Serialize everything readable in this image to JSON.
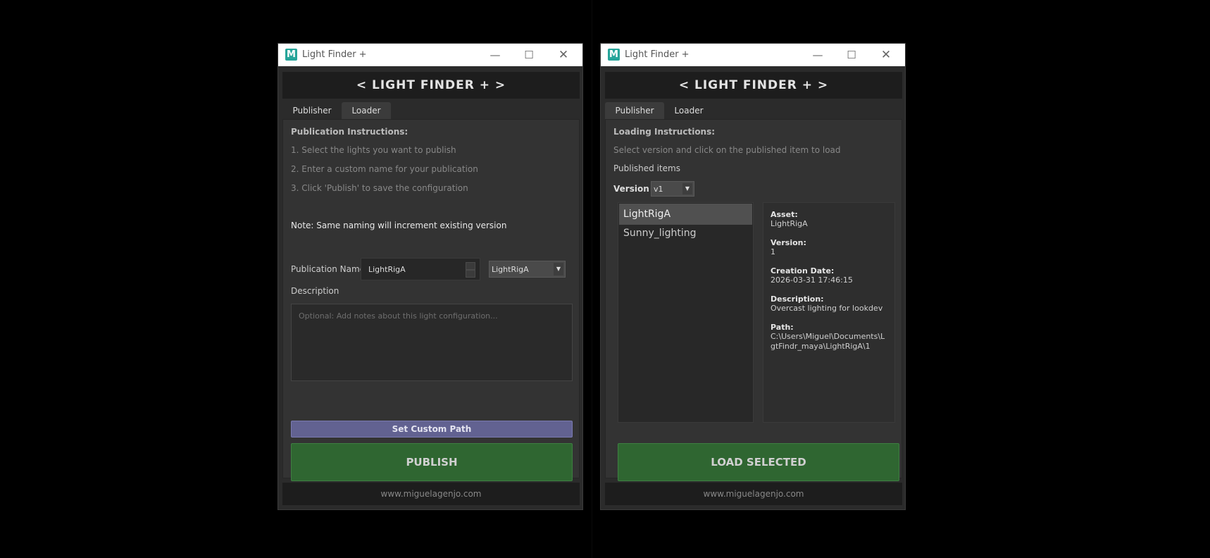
{
  "window_title": "Light Finder +",
  "header_title": "< LIGHT FINDER + >",
  "tabs": {
    "publisher": "Publisher",
    "loader": "Loader"
  },
  "publisher": {
    "instructions_heading": "Publication Instructions:",
    "steps": [
      "1. Select the lights you want to publish",
      "2. Enter a custom name for your publication",
      "3. Click 'Publish' to save the configuration"
    ],
    "note": "Note: Same naming will increment existing version",
    "publication_name_label": "Publication Name",
    "publication_name_value": "LightRigA",
    "publication_dropdown_value": "LightRigA",
    "description_label": "Description",
    "description_placeholder": "Optional: Add notes about this light configuration...",
    "set_custom_path_label": "Set Custom Path",
    "publish_label": "PUBLISH"
  },
  "loader": {
    "instructions_heading": "Loading Instructions:",
    "instructions_text": "Select version and click on the published item to load",
    "published_items_label": "Published items",
    "version_label": "Version",
    "version_value": "v1",
    "items": [
      "LightRigA",
      "Sunny_lighting"
    ],
    "selected_index": 0,
    "details": {
      "asset_label": "Asset:",
      "asset_value": "LightRigA",
      "version_label": "Version:",
      "version_value": "1",
      "creation_date_label": "Creation Date:",
      "creation_date_value": "2026-03-31 17:46:15",
      "description_label": "Description:",
      "description_value": "Overcast lighting for lookdev",
      "path_label": "Path:",
      "path_value": "C:\\Users\\Miguel\\Documents\\LgtFindr_maya\\LightRigA\\1"
    },
    "load_selected_label": "LOAD SELECTED"
  },
  "footer": "www.miguelagenjo.com",
  "icons": {
    "app": "maya-icon",
    "min": "minimize-icon",
    "max": "maximize-icon",
    "close": "close-icon"
  },
  "colors": {
    "publish_green": "#2f6631",
    "path_button": "#626291",
    "background": "#2b2b2b"
  }
}
